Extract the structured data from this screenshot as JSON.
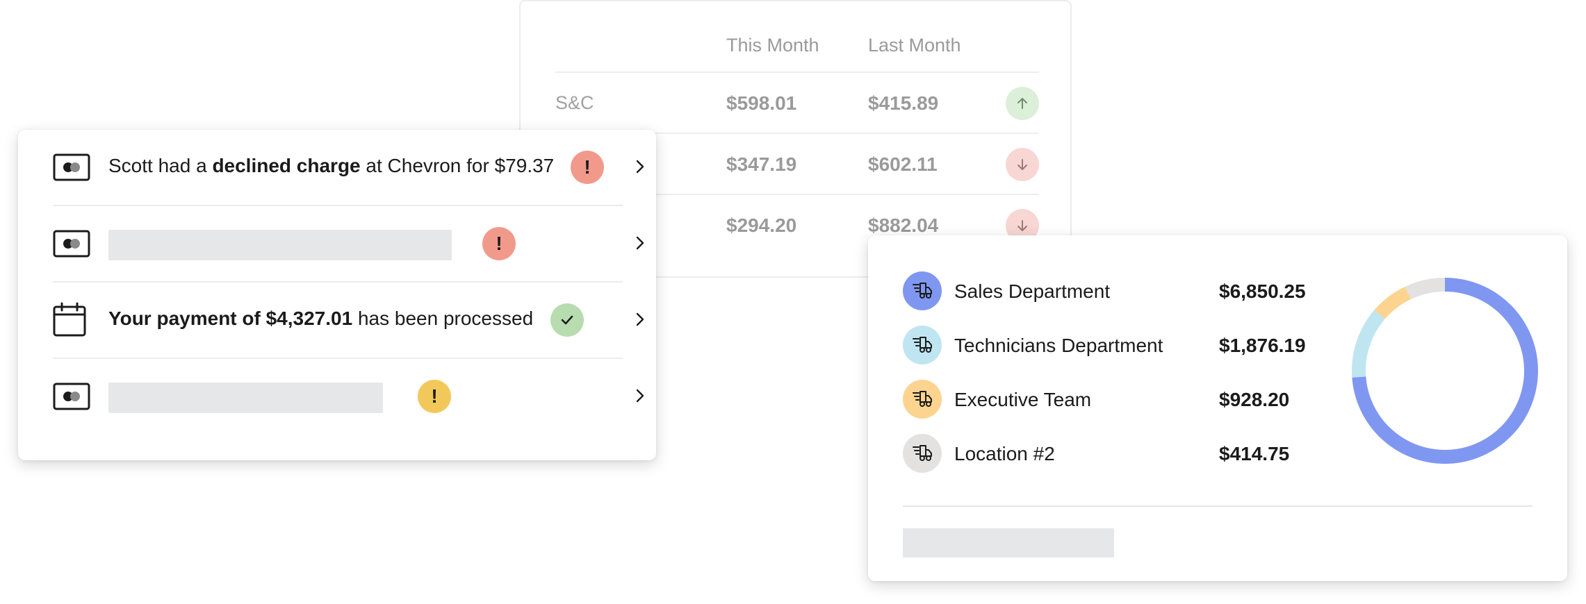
{
  "comparison_table": {
    "headers": {
      "col1": "This Month",
      "col2": "Last Month"
    },
    "rows": [
      {
        "label": "S&C",
        "this_month": "$598.01",
        "last_month": "$415.89",
        "trend": "up",
        "trend_icon": "arrow-up-icon"
      },
      {
        "label": "",
        "this_month": "$347.19",
        "last_month": "$602.11",
        "trend": "down",
        "trend_icon": "arrow-down-icon"
      },
      {
        "label": "",
        "this_month": "$294.20",
        "last_month": "$882.04",
        "trend": "down",
        "trend_icon": "arrow-down-icon"
      }
    ]
  },
  "notifications": {
    "items": [
      {
        "icon": "card-icon",
        "text_pre": "Scott had a ",
        "text_bold": "declined charge",
        "text_post": " at Chevron for $79.37",
        "badge": "!",
        "badge_type": "red"
      },
      {
        "icon": "card-icon",
        "placeholder": true,
        "badge": "!",
        "badge_type": "red"
      },
      {
        "icon": "calendar-icon",
        "text_bold": "Your payment of $4,327.01",
        "text_post": " has been processed",
        "badge_icon": "check-icon",
        "badge_type": "green"
      },
      {
        "icon": "card-icon",
        "placeholder": true,
        "badge": "!",
        "badge_type": "yellow"
      }
    ]
  },
  "departments": {
    "items": [
      {
        "name": "Sales Department",
        "amount": "$6,850.25",
        "color": "#7f97f1",
        "share": 0.738
      },
      {
        "name": "Technicians Department",
        "amount": "$1,876.19",
        "color": "#bfe5f1",
        "share": 0.125
      },
      {
        "name": "Executive Team",
        "amount": "$928.20",
        "color": "#fcd48f",
        "share": 0.066
      },
      {
        "name": "Location #2",
        "amount": "$414.75",
        "color": "#e3e2e1",
        "share": 0.071
      }
    ],
    "icon": "truck-fast-icon"
  }
}
